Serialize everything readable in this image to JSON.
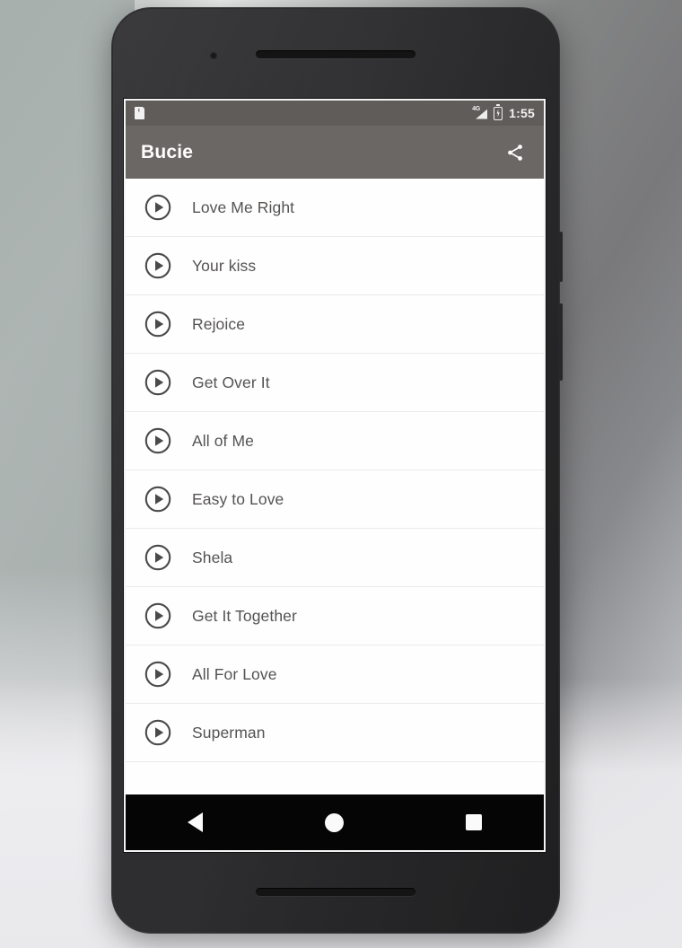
{
  "device": {
    "name": "android-phone-mockup",
    "hardware": {
      "earpiece": "earpiece-speaker",
      "front_camera": "front-camera",
      "bottom_speaker": "bottom-speaker",
      "power_button": "power-button",
      "volume_button": "volume-button"
    }
  },
  "status_bar": {
    "sd_icon": "sd-card-icon",
    "network_label": "4G",
    "signal_icon": "signal-bars-icon",
    "battery_icon": "battery-charging-icon",
    "time": "1:55",
    "background": "#605c59"
  },
  "app_bar": {
    "title": "Bucie",
    "share_icon": "share-icon",
    "background": "#6b6764",
    "title_color": "#ffffff"
  },
  "song_list": {
    "items": [
      {
        "title": "Love Me Right",
        "icon": "play-circle-icon"
      },
      {
        "title": "Your kiss",
        "icon": "play-circle-icon"
      },
      {
        "title": "Rejoice",
        "icon": "play-circle-icon"
      },
      {
        "title": "Get Over It",
        "icon": "play-circle-icon"
      },
      {
        "title": "All of Me",
        "icon": "play-circle-icon"
      },
      {
        "title": "Easy to Love",
        "icon": "play-circle-icon"
      },
      {
        "title": "Shela",
        "icon": "play-circle-icon"
      },
      {
        "title": "Get It Together",
        "icon": "play-circle-icon"
      },
      {
        "title": "All For Love",
        "icon": "play-circle-icon"
      },
      {
        "title": "Superman",
        "icon": "play-circle-icon"
      }
    ],
    "text_color": "#555352",
    "divider_color": "#eceaea",
    "background": "#fefefe"
  },
  "nav_bar": {
    "back": "back-triangle-icon",
    "home": "home-circle-icon",
    "recents": "recents-square-icon",
    "background": "#050505"
  }
}
